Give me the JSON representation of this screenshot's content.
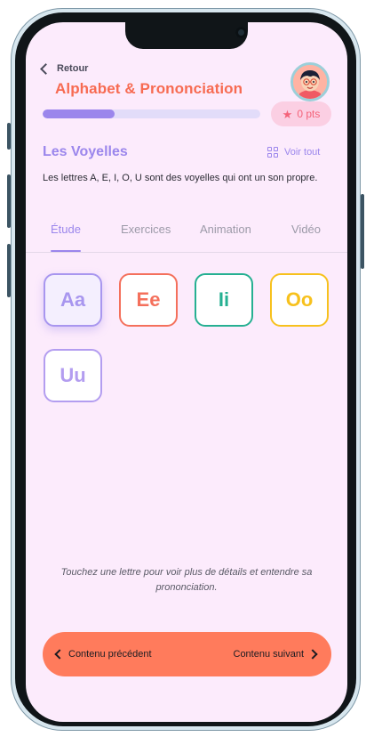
{
  "header": {
    "back_label": "Retour",
    "title": "Alphabet & Prononciation",
    "points_label": "0 pts",
    "progress": 0.33
  },
  "section": {
    "title": "Les Voyelles",
    "view_all": "Voir tout",
    "description": "Les lettres A, E, I, O, U sont des voyelles qui ont un son propre."
  },
  "tabs": [
    {
      "label": "Étude"
    },
    {
      "label": "Exercices"
    },
    {
      "label": "Animation"
    },
    {
      "label": "Vidéo"
    }
  ],
  "letters": [
    {
      "label": "Aa",
      "color": "#a896ef"
    },
    {
      "label": "Ee",
      "color": "#f4705c"
    },
    {
      "label": "Ii",
      "color": "#26b092"
    },
    {
      "label": "Oo",
      "color": "#f7c11d"
    },
    {
      "label": "Uu",
      "color": "#b39df0"
    }
  ],
  "hint": "Touchez une lettre pour voir plus de détails et entendre sa prononciation.",
  "nav": {
    "prev_label": "Contenu précédent",
    "next_label": "Contenu suivant"
  },
  "colors": {
    "accent": "#9b86ec",
    "title": "#f76b52",
    "nav_bar": "#ff7b5c",
    "background": "#fcebfc"
  }
}
